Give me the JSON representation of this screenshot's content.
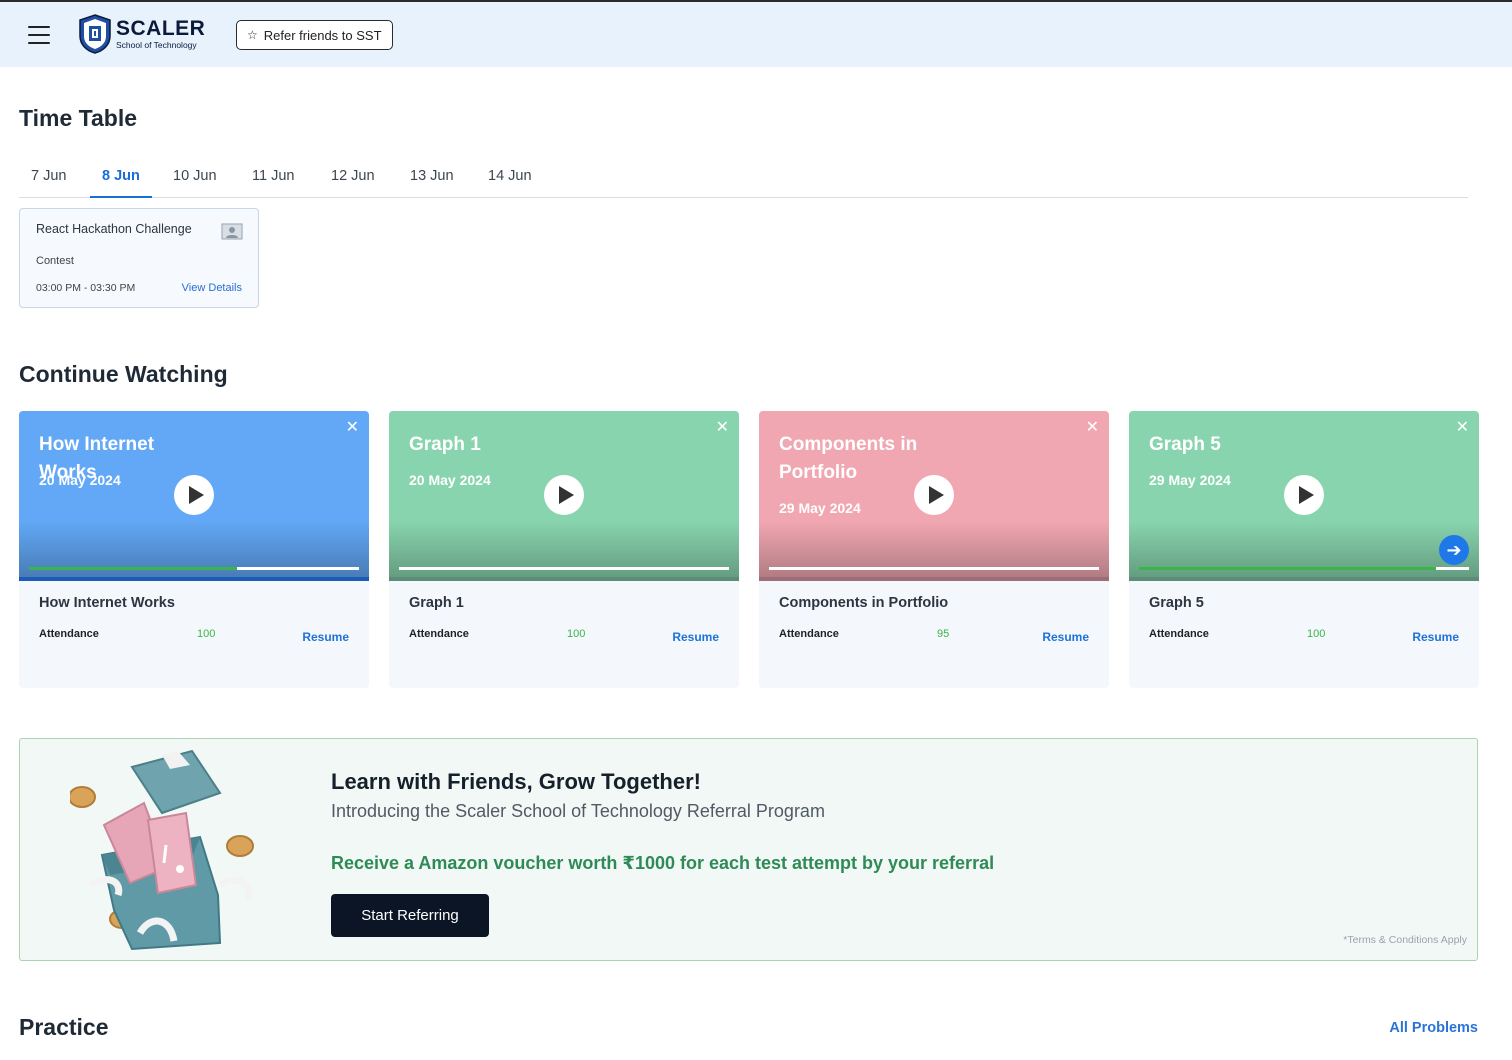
{
  "header": {
    "logo_title": "SCALER",
    "logo_subtitle": "School of Technology",
    "refer_label": "Refer friends to SST"
  },
  "timetable": {
    "title": "Time Table",
    "tabs": [
      "7 Jun",
      "8 Jun",
      "10 Jun",
      "11 Jun",
      "12 Jun",
      "13 Jun",
      "14 Jun"
    ],
    "active_tab": "8 Jun",
    "event": {
      "title": "React Hackathon Challenge",
      "type": "Contest",
      "time": "03:00 PM  -  03:30 PM",
      "link": "View Details"
    }
  },
  "continue_watching": {
    "title": "Continue Watching",
    "cards": [
      {
        "thumb_title": "How Internet Works",
        "date": "20 May 2024",
        "title": "How Internet Works",
        "attendance_label": "Attendance",
        "attendance": "100",
        "resume": "Resume",
        "color": "#62a8f6",
        "progress": 0.63
      },
      {
        "thumb_title": "Graph 1",
        "date": "20 May 2024",
        "title": "Graph 1",
        "attendance_label": "Attendance",
        "attendance": "100",
        "resume": "Resume",
        "color": "#88d4ae",
        "progress": 0.0
      },
      {
        "thumb_title": "Components in Portfolio",
        "date": "29 May 2024",
        "title": "Components in Portfolio",
        "attendance_label": "Attendance",
        "attendance": "95",
        "resume": "Resume",
        "color": "#f1a7b1",
        "progress": 0.0
      },
      {
        "thumb_title": "Graph 5",
        "date": "29 May 2024",
        "title": "Graph 5",
        "attendance_label": "Attendance",
        "attendance": "100",
        "resume": "Resume",
        "color": "#88d4ae",
        "progress": 0.9
      }
    ]
  },
  "referral": {
    "headline": "Learn with Friends, Grow Together!",
    "subtitle": "Introducing the Scaler School of Technology Referral Program",
    "offer": "Receive a Amazon voucher worth ₹1000 for each test attempt by your referral",
    "button": "Start Referring",
    "terms": "*Terms & Conditions Apply"
  },
  "practice": {
    "title": "Practice",
    "link": "All Problems"
  },
  "colors": {
    "accent": "#1a6fd6",
    "header_bg": "#e8f2fd",
    "success": "#3bb54a"
  }
}
